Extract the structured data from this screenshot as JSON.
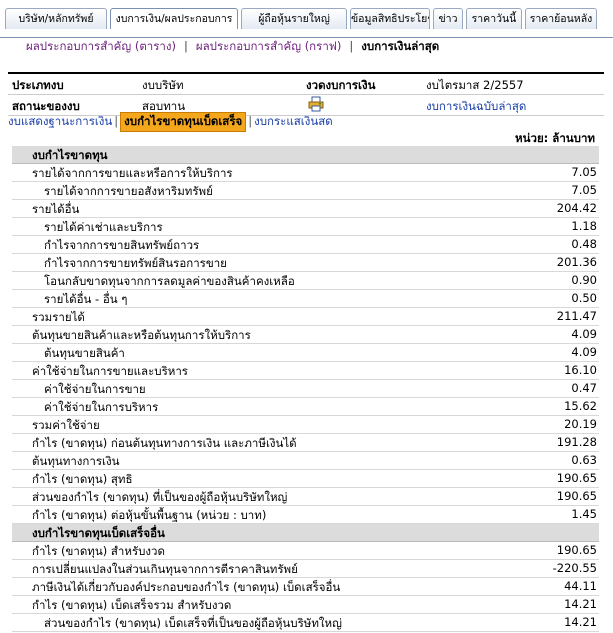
{
  "tabs": [
    {
      "label": "บริษัท/หลักทรัพย์",
      "active": false
    },
    {
      "label": "งบการเงิน/ผลประกอบการ",
      "active": true
    },
    {
      "label": "ผู้ถือหุ้นรายใหญ่",
      "active": false
    },
    {
      "label": "ข้อมูลสิทธิประโยชน์",
      "active": false
    },
    {
      "label": "ข่าว",
      "active": false
    },
    {
      "label": "ราคาวันนี้",
      "active": false
    },
    {
      "label": "ราคาย้อนหลัง",
      "active": false
    }
  ],
  "subnav": {
    "link1": "ผลประกอบการสำคัญ (ตาราง)",
    "link2": "ผลประกอบการสำคัญ (กราฟ)",
    "current": "งบการเงินล่าสุด",
    "sep": "|"
  },
  "info": {
    "type_label": "ประเภทงบ",
    "type_value": "งบบริษัท",
    "status_label": "สถานะของงบ",
    "status_value": "สอบทาน",
    "period_label": "งวดงบการเงิน",
    "period_value": "งบไตรมาส 2/2557",
    "latest_link": "งบการเงินฉบับล่าสุด"
  },
  "statement_tabs": {
    "balance": "งบแสดงฐานะการเงิน",
    "income": "งบกำไรขาดทุนเบ็ดเสร็จ",
    "cashflow": "งบกระแสเงินสด",
    "sep": "|"
  },
  "unit": "หน่วย: ล้านบาท",
  "rows": [
    {
      "label": "งบกำไรขาดทุน",
      "value": "",
      "level": "h"
    },
    {
      "label": "รายได้จากการขายและหรือการให้บริการ",
      "value": "7.05",
      "level": 0
    },
    {
      "label": "รายได้จากการขายอสังหาริมทรัพย์",
      "value": "7.05",
      "level": 1
    },
    {
      "label": "รายได้อื่น",
      "value": "204.42",
      "level": 0
    },
    {
      "label": "รายได้ค่าเช่าและบริการ",
      "value": "1.18",
      "level": 1
    },
    {
      "label": "กำไรจากการขายสินทรัพย์ถาวร",
      "value": "0.48",
      "level": 1
    },
    {
      "label": "กำไรจากการขายทรัพย์สินรอการขาย",
      "value": "201.36",
      "level": 1
    },
    {
      "label": "โอนกลับขาดทุนจากการลดมูลค่าของสินค้าคงเหลือ",
      "value": "0.90",
      "level": 1
    },
    {
      "label": "รายได้อื่น - อื่น ๆ",
      "value": "0.50",
      "level": 1
    },
    {
      "label": "รวมรายได้",
      "value": "211.47",
      "level": 0
    },
    {
      "label": "ต้นทุนขายสินค้าและหรือต้นทุนการให้บริการ",
      "value": "4.09",
      "level": 0
    },
    {
      "label": "ต้นทุนขายสินค้า",
      "value": "4.09",
      "level": 1
    },
    {
      "label": "ค่าใช้จ่ายในการขายและบริหาร",
      "value": "16.10",
      "level": 0
    },
    {
      "label": "ค่าใช้จ่ายในการขาย",
      "value": "0.47",
      "level": 1
    },
    {
      "label": "ค่าใช้จ่ายในการบริหาร",
      "value": "15.62",
      "level": 1
    },
    {
      "label": "รวมค่าใช้จ่าย",
      "value": "20.19",
      "level": 0
    },
    {
      "label": "กำไร (ขาดทุน) ก่อนต้นทุนทางการเงิน และภาษีเงินได้",
      "value": "191.28",
      "level": 0
    },
    {
      "label": "ต้นทุนทางการเงิน",
      "value": "0.63",
      "level": 0
    },
    {
      "label": "กำไร (ขาดทุน) สุทธิ",
      "value": "190.65",
      "level": 0
    },
    {
      "label": "ส่วนของกำไร (ขาดทุน) ที่เป็นของผู้ถือหุ้นบริษัทใหญ่",
      "value": "190.65",
      "level": 0
    },
    {
      "label": "กำไร (ขาดทุน) ต่อหุ้นขั้นพื้นฐาน (หน่วย : บาท)",
      "value": "1.45",
      "level": 0
    },
    {
      "label": "งบกำไรขาดทุนเบ็ดเสร็จอื่น",
      "value": "",
      "level": "h"
    },
    {
      "label": "กำไร (ขาดทุน) สำหรับงวด",
      "value": "190.65",
      "level": 0
    },
    {
      "label": "การเปลี่ยนแปลงในส่วนเกินทุนจากการตีราคาสินทรัพย์",
      "value": "-220.55",
      "level": 0
    },
    {
      "label": "ภาษีเงินได้เกี่ยวกับองค์ประกอบของกำไร (ขาดทุน) เบ็ดเสร็จอื่น",
      "value": "44.11",
      "level": 0
    },
    {
      "label": "กำไร (ขาดทุน) เบ็ดเสร็จรวม สำหรับงวด",
      "value": "14.21",
      "level": 0
    },
    {
      "label": "ส่วนของกำไร (ขาดทุน) เบ็ดเสร็จที่เป็นของผู้ถือหุ้นบริษัทใหญ่",
      "value": "14.21",
      "level": 1
    }
  ]
}
